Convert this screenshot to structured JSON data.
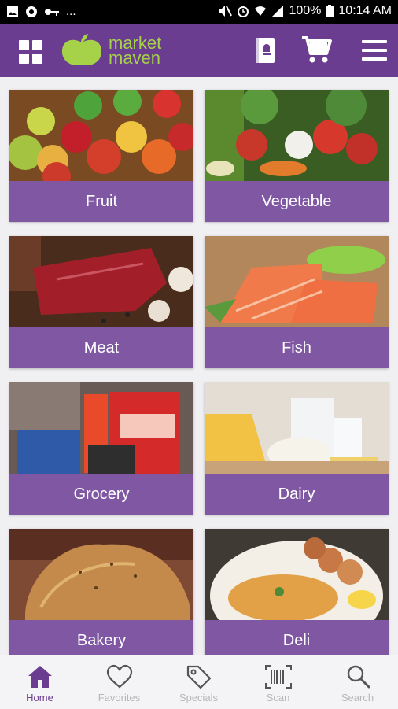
{
  "status_bar": {
    "battery": "100%",
    "time": "10:14 AM",
    "more_indicator": "...",
    "icons": [
      "image-icon",
      "chrome-icon",
      "key-icon",
      "mute-icon",
      "alarm-icon",
      "wifi-icon",
      "signal-icon",
      "battery-icon"
    ]
  },
  "app_bar": {
    "logo_line1": "market",
    "logo_line2": "maven",
    "icons": [
      "grid-menu-icon",
      "recipe-book-icon",
      "cart-icon",
      "hamburger-menu-icon"
    ]
  },
  "categories": [
    {
      "label": "Fruit"
    },
    {
      "label": "Vegetable"
    },
    {
      "label": "Meat"
    },
    {
      "label": "Fish"
    },
    {
      "label": "Grocery"
    },
    {
      "label": "Dairy"
    },
    {
      "label": "Bakery"
    },
    {
      "label": "Deli"
    }
  ],
  "bottom_nav": [
    {
      "label": "Home",
      "icon": "home-icon",
      "active": true
    },
    {
      "label": "Favorites",
      "icon": "heart-icon",
      "active": false
    },
    {
      "label": "Specials",
      "icon": "tag-icon",
      "active": false
    },
    {
      "label": "Scan",
      "icon": "barcode-icon",
      "active": false
    },
    {
      "label": "Search",
      "icon": "search-icon",
      "active": false
    }
  ],
  "colors": {
    "primary": "#6a3d91",
    "logo_green": "#a6d24a",
    "inactive": "#b7b7b7",
    "background": "#f0eff2"
  }
}
